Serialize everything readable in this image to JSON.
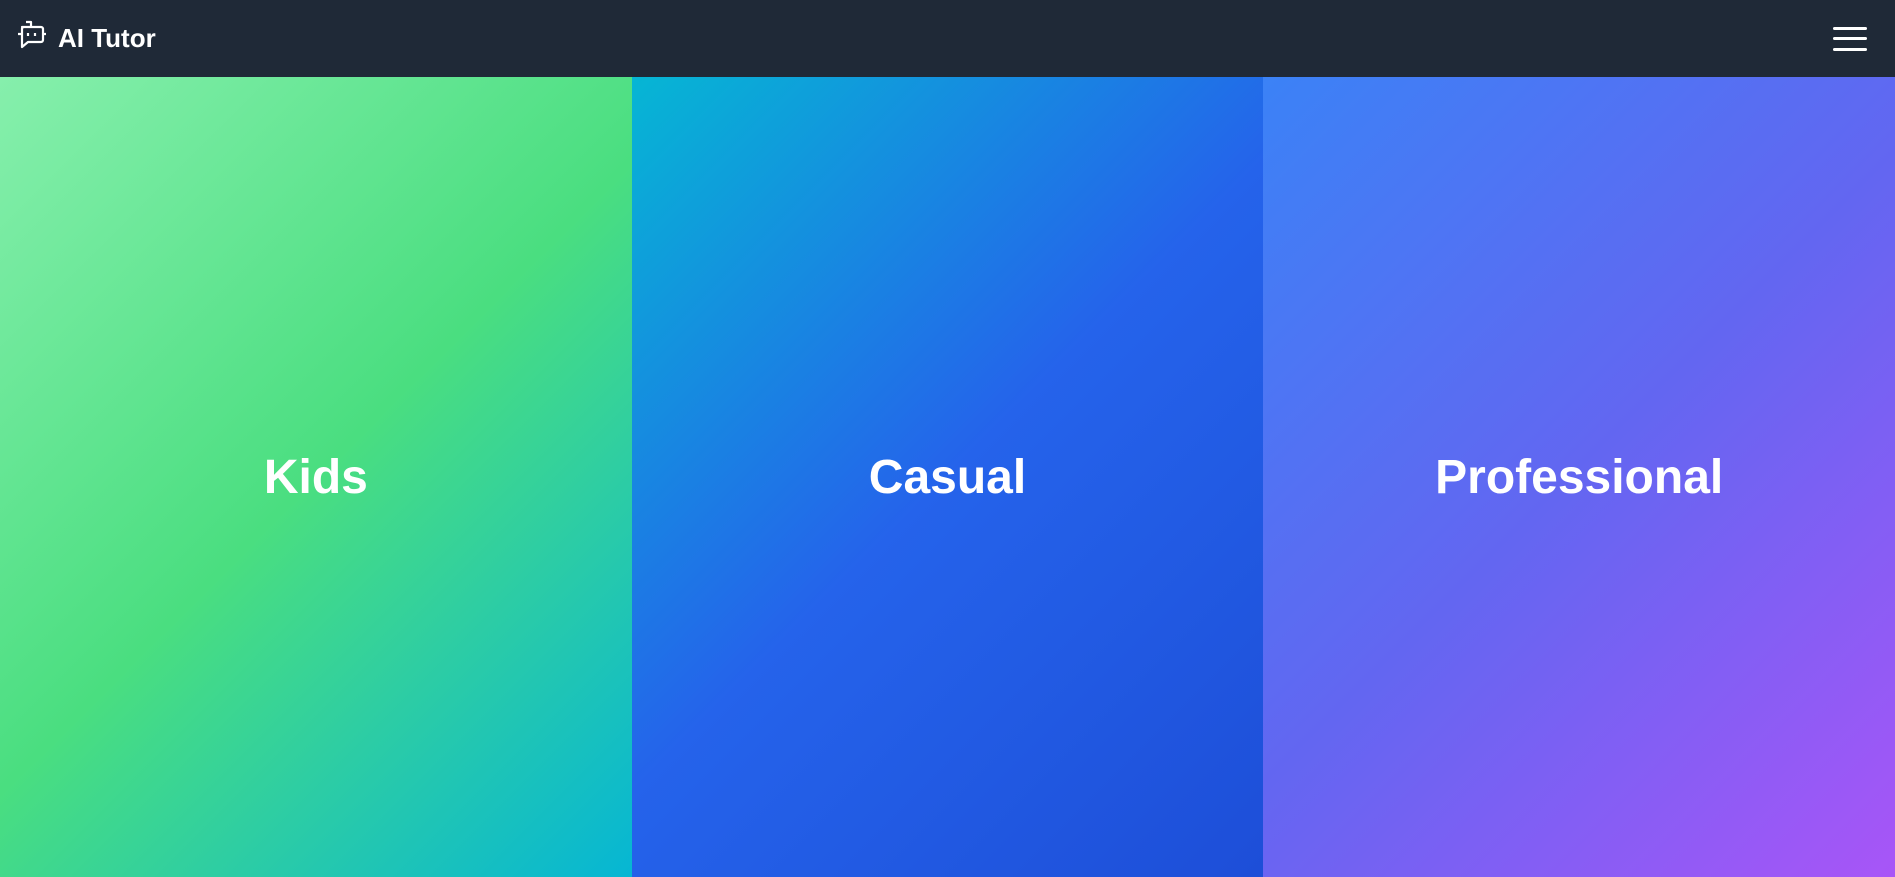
{
  "header": {
    "title": "AI Tutor",
    "logo_icon": "robot-chat-icon",
    "menu_icon": "hamburger-menu-icon"
  },
  "modes": [
    {
      "label": "Kids",
      "colors": [
        "#86efac",
        "#4ade80",
        "#06b6d4"
      ]
    },
    {
      "label": "Casual",
      "colors": [
        "#06b6d4",
        "#2563eb",
        "#1d4ed8"
      ]
    },
    {
      "label": "Professional",
      "colors": [
        "#3b82f6",
        "#6366f1",
        "#a855f7"
      ]
    }
  ]
}
